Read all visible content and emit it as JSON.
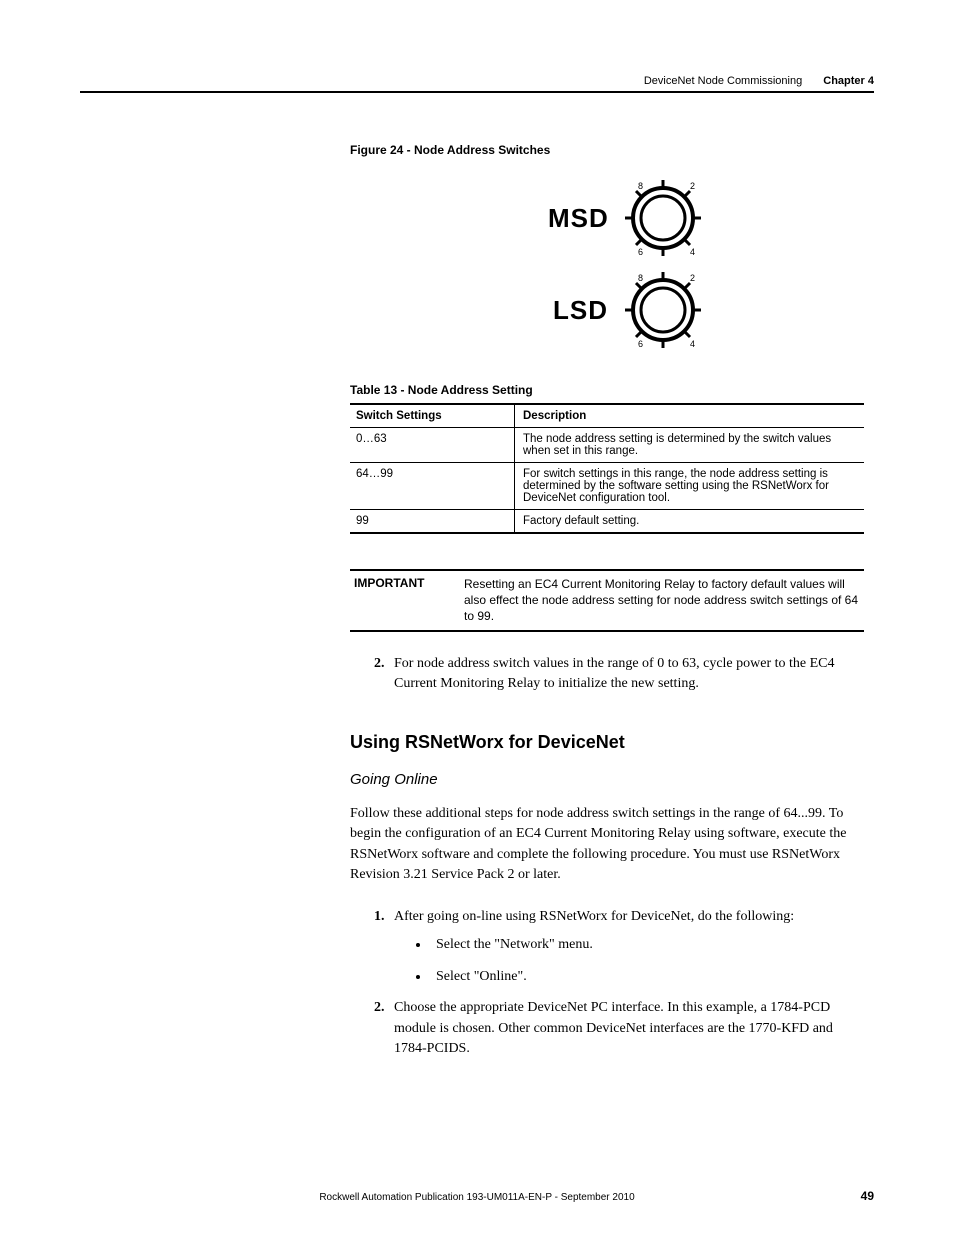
{
  "header": {
    "section": "DeviceNet Node Commissioning",
    "chapter": "Chapter 4"
  },
  "figure": {
    "caption": "Figure 24 - Node Address Switches",
    "dial1_label": "MSD",
    "dial2_label": "LSD"
  },
  "table": {
    "caption": "Table 13 -  Node Address Setting",
    "head_col1": "Switch Settings",
    "head_col2": "Description",
    "rows": [
      {
        "c1": "0…63",
        "c2": "The node address setting is determined by the switch values when set in this range."
      },
      {
        "c1": "64…99",
        "c2": "For switch settings in this range, the node address setting is determined by the software setting using the RSNetWorx for DeviceNet configuration tool."
      },
      {
        "c1": "99",
        "c2": "Factory default setting."
      }
    ]
  },
  "important": {
    "label": "IMPORTANT",
    "text": "Resetting an EC4 Current Monitoring Relay to factory default values will also effect the node address setting for node address switch settings of 64 to 99."
  },
  "step2": "For node address switch values in the range of 0 to 63, cycle power to the EC4 Current Monitoring Relay to initialize the new setting.",
  "section_h2": "Using RSNetWorx for DeviceNet",
  "section_h3": "Going Online",
  "para1": "Follow these additional steps for node address switch settings in the range of 64...99. To begin the configuration of an EC4 Current Monitoring Relay using software, execute the RSNetWorx software and complete the following procedure. You must use RSNetWorx Revision 3.21 Service Pack 2 or later.",
  "ol": {
    "item1": "After going on-line using RSNetWorx for DeviceNet, do the following:",
    "item1_sub1": "Select the \"Network\" menu.",
    "item1_sub2": "Select \"Online\".",
    "item2": "Choose the appropriate DeviceNet PC interface. In this example, a 1784-PCD module is chosen. Other common DeviceNet interfaces are the 1770-KFD and 1784-PCIDS."
  },
  "footer": {
    "pub": "Rockwell Automation Publication 193-UM011A-EN-P - September 2010",
    "page": "49"
  }
}
